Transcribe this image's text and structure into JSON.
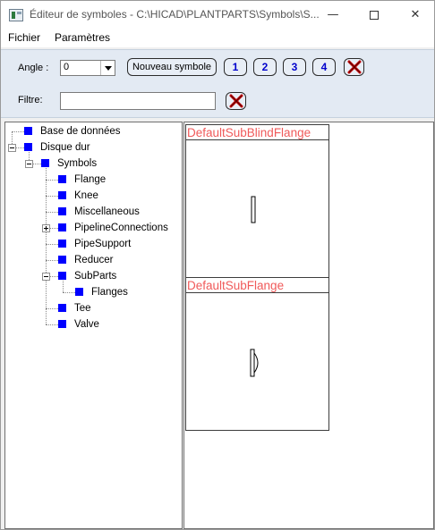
{
  "window": {
    "title": "Éditeur de symboles - C:\\HICAD\\PLANTPARTS\\Symbols\\S...",
    "minimize_glyph": "—",
    "close_glyph": "✕"
  },
  "menubar": {
    "items": [
      "Fichier",
      "Paramètres"
    ]
  },
  "toolbar": {
    "angle_label": "Angle :",
    "angle_value": "0",
    "new_symbol_label": "Nouveau symbole",
    "number_buttons": [
      "1",
      "2",
      "3",
      "4"
    ],
    "filter_label": "Filtre:",
    "filter_value": ""
  },
  "tree": {
    "items": [
      {
        "label": "Base de données"
      },
      {
        "label": "Disque dur"
      },
      {
        "label": "Symbols"
      },
      {
        "label": "Flange"
      },
      {
        "label": "Knee"
      },
      {
        "label": "Miscellaneous"
      },
      {
        "label": "PipelineConnections"
      },
      {
        "label": "PipeSupport"
      },
      {
        "label": "Reducer"
      },
      {
        "label": "SubParts"
      },
      {
        "label": "Flanges"
      },
      {
        "label": "Tee"
      },
      {
        "label": "Valve"
      }
    ]
  },
  "symbols": [
    {
      "name": "DefaultSubBlindFlange"
    },
    {
      "name": "DefaultSubFlange"
    }
  ],
  "colors": {
    "tree_square": "#0000ff",
    "symbol_title": "#f05a5a",
    "number_text": "#0000cc",
    "delete_x": "#c00000",
    "toolbar_bg": "#e3eaf3"
  }
}
